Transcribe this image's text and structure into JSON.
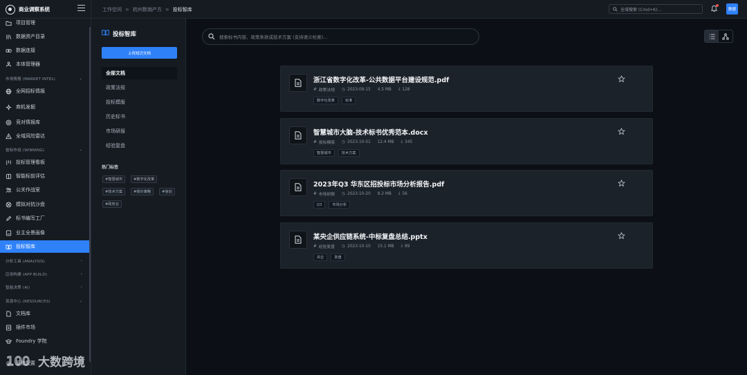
{
  "app": {
    "brand": "商业调察系统"
  },
  "breadcrumb": [
    "工作空间",
    "杭州数销产方",
    "投标智库"
  ],
  "global_search": {
    "placeholder": "全域搜索 (Cmd+K)..."
  },
  "user": {
    "avatar_text": "数据"
  },
  "nav": {
    "items_top": [
      {
        "label": "项目管理",
        "icon": "folder-icon"
      },
      {
        "label": "数据资产目录",
        "icon": "library-icon"
      },
      {
        "label": "数据连接",
        "icon": "link-icon"
      },
      {
        "label": "本体管理器",
        "icon": "ontology-icon"
      }
    ],
    "section_market": "市场情报 (MARKET INTEL)",
    "items_market": [
      {
        "label": "全网招标情报",
        "icon": "globe-icon"
      },
      {
        "label": "商机发掘",
        "icon": "sparkle-icon"
      },
      {
        "label": "竞对情报库",
        "icon": "target-icon"
      },
      {
        "label": "全域风险雷达",
        "icon": "radar-icon"
      }
    ],
    "section_winning": "投标作战 (WINNING)",
    "items_winning": [
      {
        "label": "投标管理看板",
        "icon": "kanban-icon"
      },
      {
        "label": "智能标前评估",
        "icon": "brain-icon"
      },
      {
        "label": "公关作战室",
        "icon": "people-icon"
      },
      {
        "label": "模拟对抗沙盘",
        "icon": "swords-icon"
      },
      {
        "label": "标书编写工厂",
        "icon": "pen-icon"
      },
      {
        "label": "业主全景画像",
        "icon": "id-card-icon"
      },
      {
        "label": "投标智库",
        "icon": "book-icon"
      }
    ],
    "section_analysis": "分析工具 (ANALYSIS)",
    "section_app": "应用构建 (APP BUILD)",
    "section_ai": "智能决策 (AI)",
    "section_resources": "资源中心 (RESOURCES)",
    "items_resources": [
      {
        "label": "文档库",
        "icon": "doc-icon"
      },
      {
        "label": "插件市场",
        "icon": "plugin-icon"
      },
      {
        "label": "Foundry 学院",
        "icon": "graduation-icon"
      }
    ],
    "bottom_label": "系统配置"
  },
  "library": {
    "title": "投标智库",
    "upload_label": "上传知识文档",
    "categories": [
      "全部文档",
      "政策法规",
      "投标模版",
      "历史标书",
      "市场研报",
      "经验复盘"
    ],
    "hot_title": "热门标签",
    "hot_tags": [
      "#智慧城市",
      "#数字化改革",
      "#技术方案",
      "#报价策略",
      "#信创",
      "#政务云"
    ]
  },
  "search": {
    "placeholder": "搜索标书内容、政策条款或技术方案 (支持语义检索)..."
  },
  "documents": [
    {
      "title": "浙江省数字化改革-公共数据平台建设规范.pdf",
      "category": "政策法规",
      "date": "2023-09-15",
      "size": "4.5 MB",
      "downloads": "128",
      "tags": [
        "数字化改革",
        "标准"
      ]
    },
    {
      "title": "智慧城市大脑-技术标书优秀范本.docx",
      "category": "投标模版",
      "date": "2023-10-01",
      "size": "12.4 MB",
      "downloads": "345",
      "tags": [
        "智慧城市",
        "技术方案"
      ]
    },
    {
      "title": "2023年Q3 华东区招投标市场分析报告.pdf",
      "category": "市场研报",
      "date": "2023-10-20",
      "size": "8.2 MB",
      "downloads": "56",
      "tags": [
        "Q3",
        "市场分析"
      ]
    },
    {
      "title": "某央企供应链系统-中标复盘总结.pptx",
      "category": "经验复盘",
      "date": "2023-10-10",
      "size": "15.1 MB",
      "downloads": "89",
      "tags": [
        "央企",
        "复盘"
      ]
    }
  ],
  "watermark": {
    "text": "大数跨境"
  },
  "colors": {
    "accent": "#2f81f7",
    "background": "#0c1016",
    "panel": "#161b22",
    "card": "#1c222a"
  }
}
